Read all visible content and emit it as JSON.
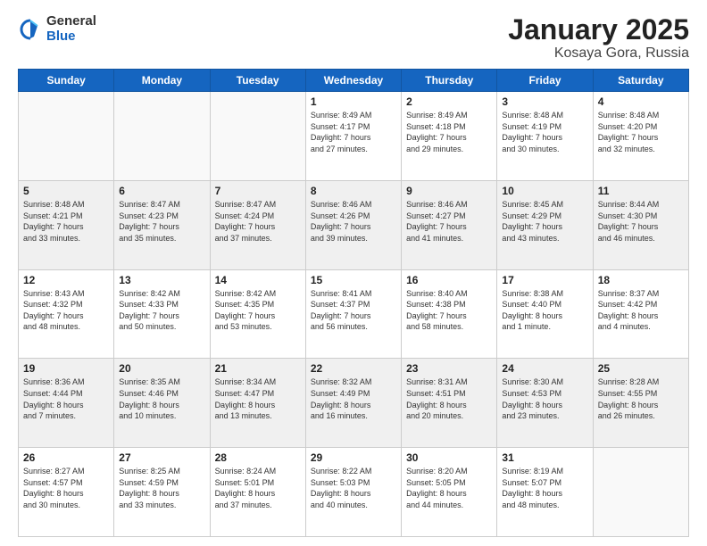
{
  "logo": {
    "general": "General",
    "blue": "Blue"
  },
  "title": "January 2025",
  "location": "Kosaya Gora, Russia",
  "days_of_week": [
    "Sunday",
    "Monday",
    "Tuesday",
    "Wednesday",
    "Thursday",
    "Friday",
    "Saturday"
  ],
  "weeks": [
    [
      {
        "day": "",
        "info": ""
      },
      {
        "day": "",
        "info": ""
      },
      {
        "day": "",
        "info": ""
      },
      {
        "day": "1",
        "info": "Sunrise: 8:49 AM\nSunset: 4:17 PM\nDaylight: 7 hours\nand 27 minutes."
      },
      {
        "day": "2",
        "info": "Sunrise: 8:49 AM\nSunset: 4:18 PM\nDaylight: 7 hours\nand 29 minutes."
      },
      {
        "day": "3",
        "info": "Sunrise: 8:48 AM\nSunset: 4:19 PM\nDaylight: 7 hours\nand 30 minutes."
      },
      {
        "day": "4",
        "info": "Sunrise: 8:48 AM\nSunset: 4:20 PM\nDaylight: 7 hours\nand 32 minutes."
      }
    ],
    [
      {
        "day": "5",
        "info": "Sunrise: 8:48 AM\nSunset: 4:21 PM\nDaylight: 7 hours\nand 33 minutes."
      },
      {
        "day": "6",
        "info": "Sunrise: 8:47 AM\nSunset: 4:23 PM\nDaylight: 7 hours\nand 35 minutes."
      },
      {
        "day": "7",
        "info": "Sunrise: 8:47 AM\nSunset: 4:24 PM\nDaylight: 7 hours\nand 37 minutes."
      },
      {
        "day": "8",
        "info": "Sunrise: 8:46 AM\nSunset: 4:26 PM\nDaylight: 7 hours\nand 39 minutes."
      },
      {
        "day": "9",
        "info": "Sunrise: 8:46 AM\nSunset: 4:27 PM\nDaylight: 7 hours\nand 41 minutes."
      },
      {
        "day": "10",
        "info": "Sunrise: 8:45 AM\nSunset: 4:29 PM\nDaylight: 7 hours\nand 43 minutes."
      },
      {
        "day": "11",
        "info": "Sunrise: 8:44 AM\nSunset: 4:30 PM\nDaylight: 7 hours\nand 46 minutes."
      }
    ],
    [
      {
        "day": "12",
        "info": "Sunrise: 8:43 AM\nSunset: 4:32 PM\nDaylight: 7 hours\nand 48 minutes."
      },
      {
        "day": "13",
        "info": "Sunrise: 8:42 AM\nSunset: 4:33 PM\nDaylight: 7 hours\nand 50 minutes."
      },
      {
        "day": "14",
        "info": "Sunrise: 8:42 AM\nSunset: 4:35 PM\nDaylight: 7 hours\nand 53 minutes."
      },
      {
        "day": "15",
        "info": "Sunrise: 8:41 AM\nSunset: 4:37 PM\nDaylight: 7 hours\nand 56 minutes."
      },
      {
        "day": "16",
        "info": "Sunrise: 8:40 AM\nSunset: 4:38 PM\nDaylight: 7 hours\nand 58 minutes."
      },
      {
        "day": "17",
        "info": "Sunrise: 8:38 AM\nSunset: 4:40 PM\nDaylight: 8 hours\nand 1 minute."
      },
      {
        "day": "18",
        "info": "Sunrise: 8:37 AM\nSunset: 4:42 PM\nDaylight: 8 hours\nand 4 minutes."
      }
    ],
    [
      {
        "day": "19",
        "info": "Sunrise: 8:36 AM\nSunset: 4:44 PM\nDaylight: 8 hours\nand 7 minutes."
      },
      {
        "day": "20",
        "info": "Sunrise: 8:35 AM\nSunset: 4:46 PM\nDaylight: 8 hours\nand 10 minutes."
      },
      {
        "day": "21",
        "info": "Sunrise: 8:34 AM\nSunset: 4:47 PM\nDaylight: 8 hours\nand 13 minutes."
      },
      {
        "day": "22",
        "info": "Sunrise: 8:32 AM\nSunset: 4:49 PM\nDaylight: 8 hours\nand 16 minutes."
      },
      {
        "day": "23",
        "info": "Sunrise: 8:31 AM\nSunset: 4:51 PM\nDaylight: 8 hours\nand 20 minutes."
      },
      {
        "day": "24",
        "info": "Sunrise: 8:30 AM\nSunset: 4:53 PM\nDaylight: 8 hours\nand 23 minutes."
      },
      {
        "day": "25",
        "info": "Sunrise: 8:28 AM\nSunset: 4:55 PM\nDaylight: 8 hours\nand 26 minutes."
      }
    ],
    [
      {
        "day": "26",
        "info": "Sunrise: 8:27 AM\nSunset: 4:57 PM\nDaylight: 8 hours\nand 30 minutes."
      },
      {
        "day": "27",
        "info": "Sunrise: 8:25 AM\nSunset: 4:59 PM\nDaylight: 8 hours\nand 33 minutes."
      },
      {
        "day": "28",
        "info": "Sunrise: 8:24 AM\nSunset: 5:01 PM\nDaylight: 8 hours\nand 37 minutes."
      },
      {
        "day": "29",
        "info": "Sunrise: 8:22 AM\nSunset: 5:03 PM\nDaylight: 8 hours\nand 40 minutes."
      },
      {
        "day": "30",
        "info": "Sunrise: 8:20 AM\nSunset: 5:05 PM\nDaylight: 8 hours\nand 44 minutes."
      },
      {
        "day": "31",
        "info": "Sunrise: 8:19 AM\nSunset: 5:07 PM\nDaylight: 8 hours\nand 48 minutes."
      },
      {
        "day": "",
        "info": ""
      }
    ]
  ]
}
